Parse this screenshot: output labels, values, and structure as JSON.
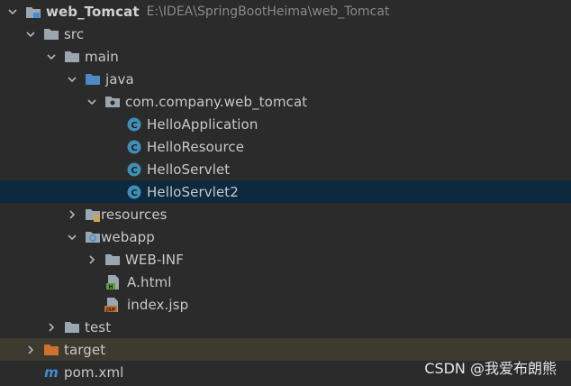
{
  "project": {
    "name": "web_Tomcat",
    "path": "E:\\IDEA\\SpringBootHeima\\web_Tomcat"
  },
  "tree": {
    "src": "src",
    "main": "main",
    "java": "java",
    "package": "com.company.web_tomcat",
    "classes": [
      "HelloApplication",
      "HelloResource",
      "HelloServlet",
      "HelloServlet2"
    ],
    "resources": "resources",
    "webapp": "webapp",
    "web_inf": "WEB-INF",
    "a_html": "A.html",
    "index_jsp": "index.jsp",
    "test": "test",
    "target": "target",
    "pom": "pom.xml"
  },
  "selected": "HelloServlet2",
  "icons": {
    "module": "module-folder-icon",
    "folder": "folder-icon",
    "source_folder": "source-folder-icon",
    "package": "package-icon",
    "class": "class-icon",
    "resources": "resources-folder-icon",
    "web": "web-folder-icon",
    "html": "html-file-icon",
    "jsp": "jsp-file-icon",
    "excluded": "excluded-folder-icon",
    "maven": "maven-icon"
  },
  "colors": {
    "background": "#2b2b2b",
    "selection": "#0d293e",
    "excluded_row": "#3d3a2f",
    "class_icon": "#3f8fb7",
    "folder": "#9aa7b0",
    "source_folder": "#4d89c9",
    "excluded_folder": "#d0702f",
    "maven": "#3c8fd6"
  },
  "watermark": "CSDN @我爱布朗熊"
}
